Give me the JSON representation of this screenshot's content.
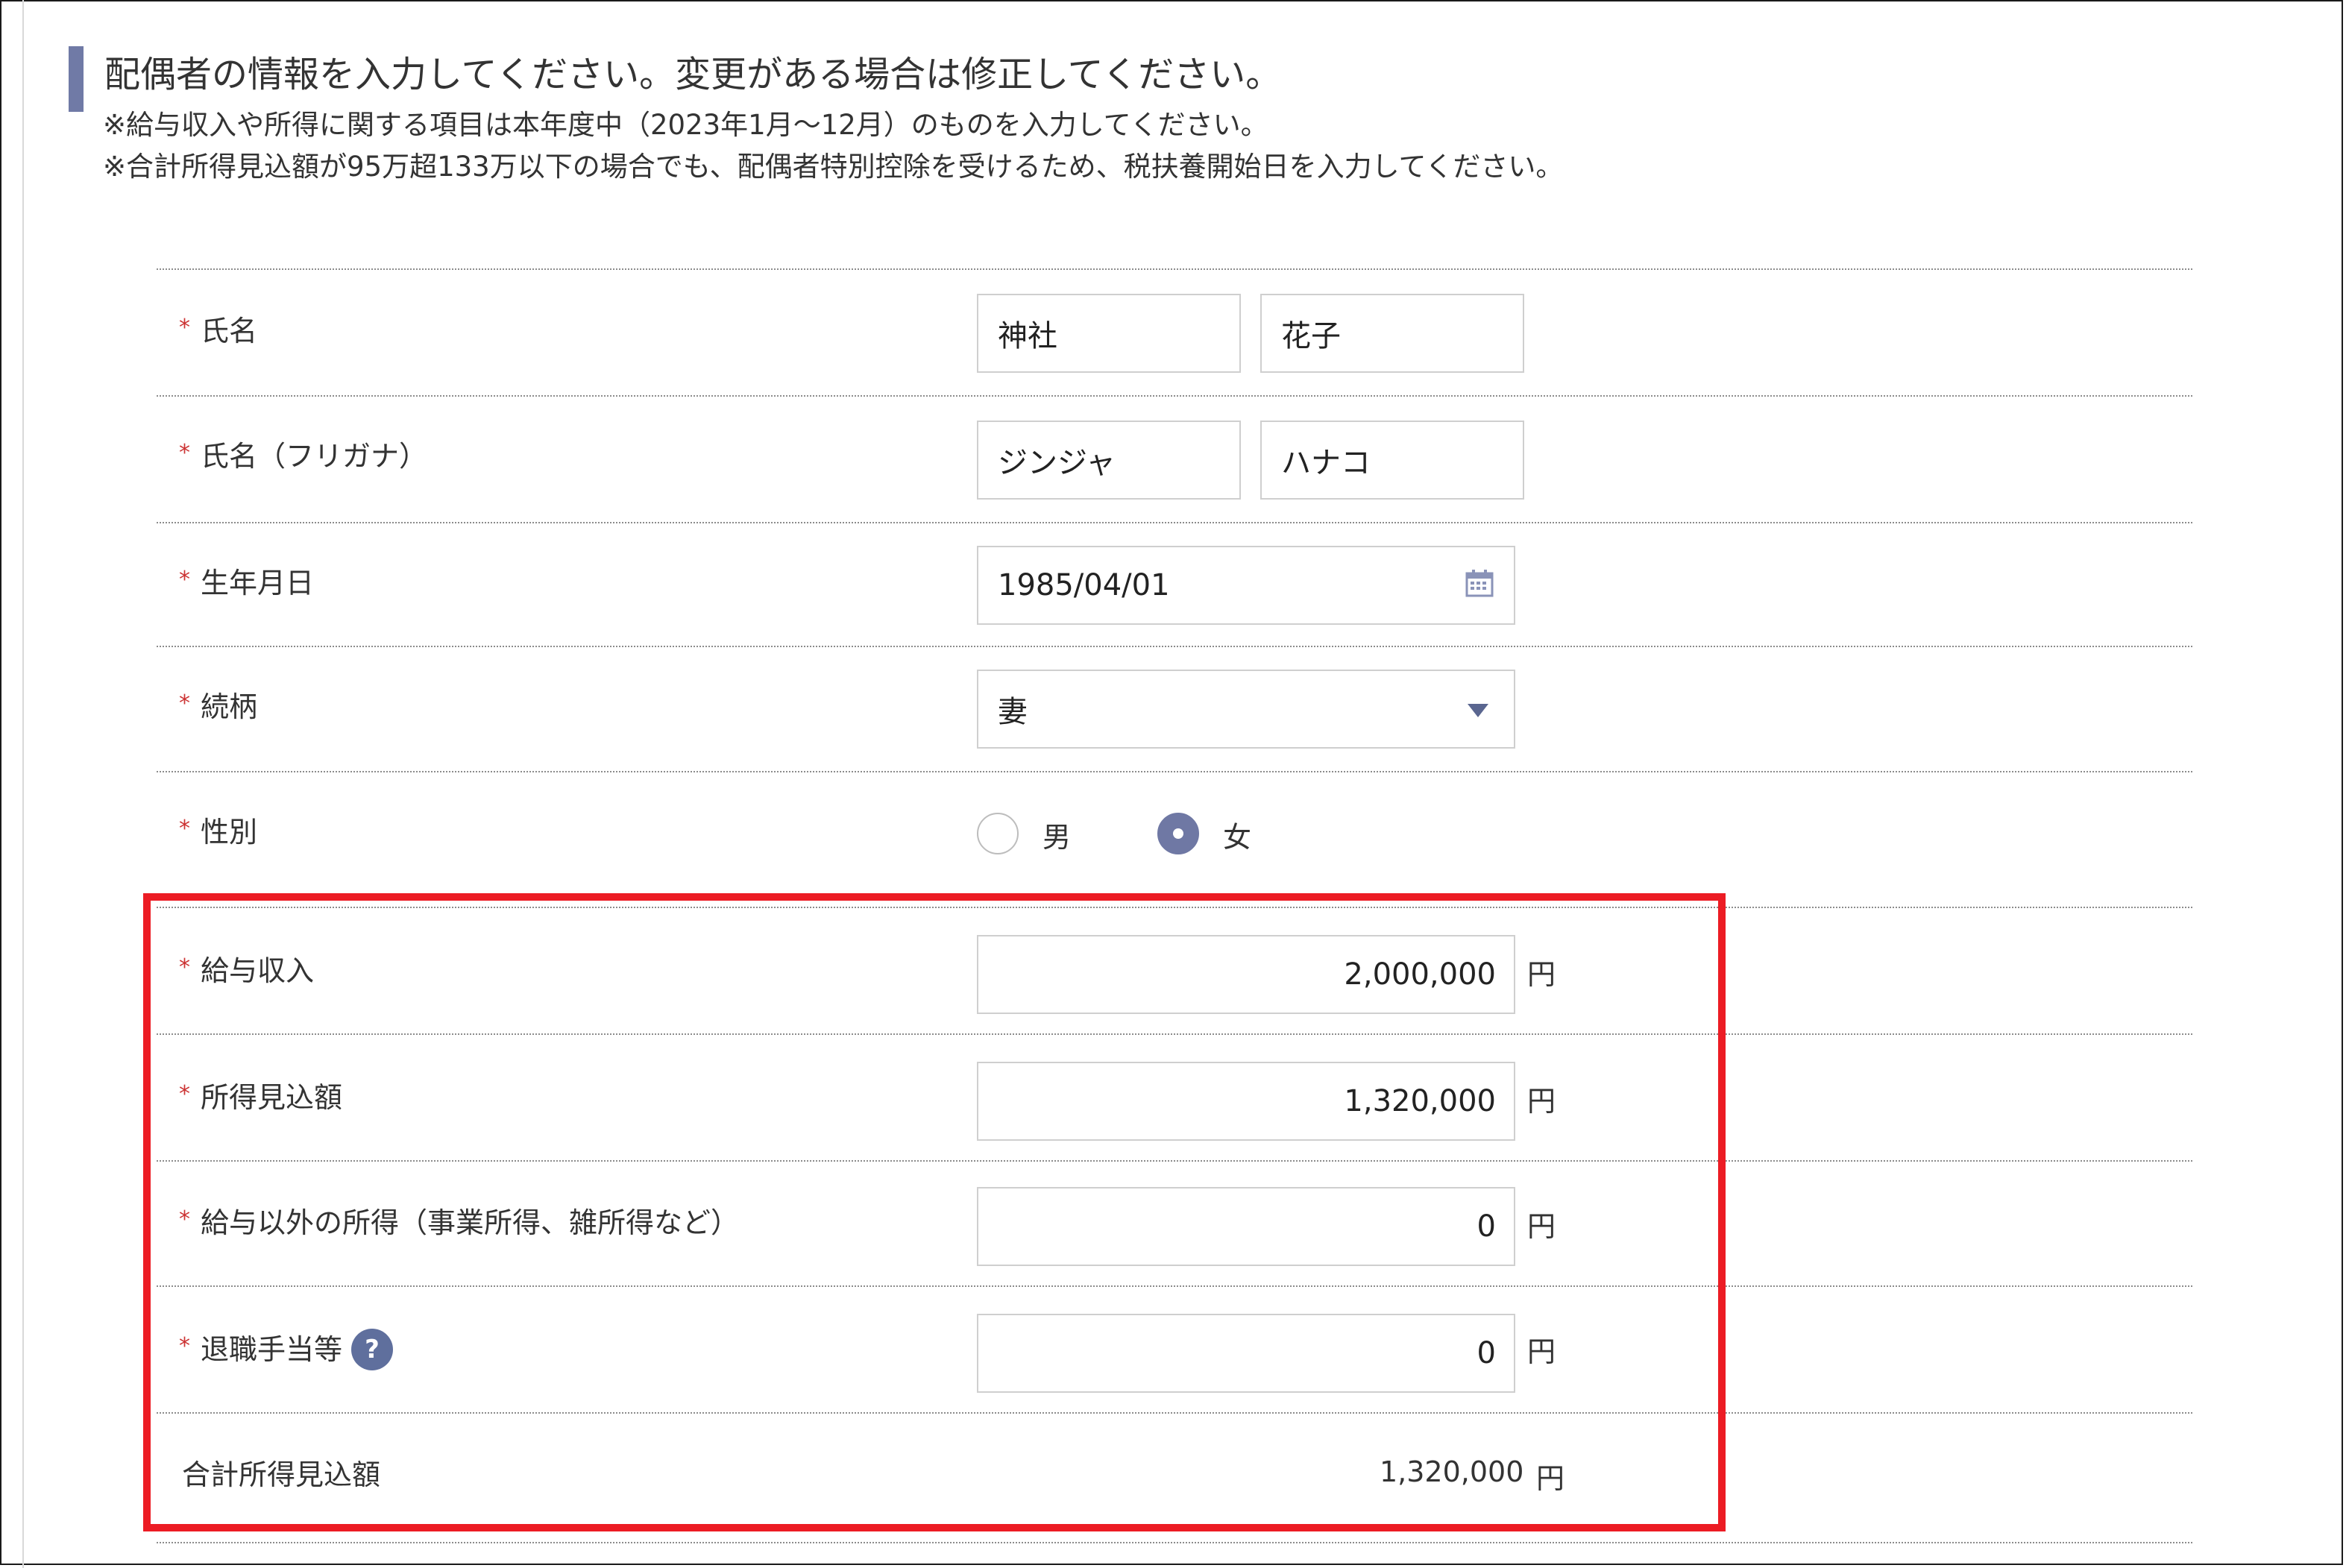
{
  "header": {
    "title": "配偶者の情報を入力してください。変更がある場合は修正してください。",
    "note1": "※給与収入や所得に関する項目は本年度中（2023年1月～12月）のものを入力してください。",
    "note2": "※合計所得見込額が95万超133万以下の場合でも、配偶者特別控除を受けるため、税扶養開始日を入力してください。"
  },
  "required_mark": "*",
  "form": {
    "name": {
      "label": "氏名",
      "last": "神社",
      "first": "花子"
    },
    "kana": {
      "label": "氏名（フリガナ）",
      "last": "ジンジャ",
      "first": "ハナコ"
    },
    "birth": {
      "label": "生年月日",
      "value": "1985/04/01",
      "icon": "calendar-icon"
    },
    "relation": {
      "label": "続柄",
      "value": "妻",
      "icon": "chevron-down-icon"
    },
    "gender": {
      "label": "性別",
      "options": [
        "男",
        "女"
      ],
      "selected": "女"
    },
    "salary": {
      "label": "給与収入",
      "value": "2,000,000",
      "unit": "円"
    },
    "income_estimate": {
      "label": "所得見込額",
      "value": "1,320,000",
      "unit": "円"
    },
    "other_income": {
      "label": "給与以外の所得（事業所得、雑所得など）",
      "value": "0",
      "unit": "円"
    },
    "retirement": {
      "label": "退職手当等",
      "value": "0",
      "unit": "円",
      "help": "?"
    },
    "total": {
      "label": "合計所得見込額",
      "value": "1,320,000",
      "unit": "円"
    }
  },
  "colors": {
    "accent": "#707aa6",
    "highlight": "#ec1c24",
    "required": "#cc3333"
  }
}
